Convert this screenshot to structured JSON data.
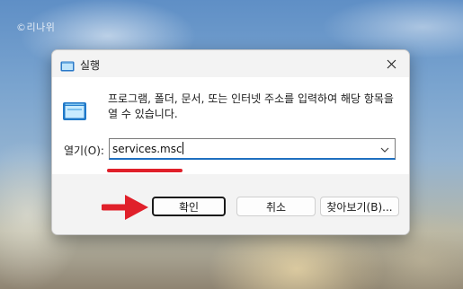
{
  "watermark": "©리나위",
  "dialog": {
    "title": "실행",
    "description": "프로그램, 폴더, 문서, 또는 인터넷 주소를 입력하여 해당 항목을 열 수 있습니다.",
    "open_label": "열기(O):",
    "open_value": "services.msc",
    "buttons": {
      "ok": "확인",
      "cancel": "취소",
      "browse": "찾아보기(B)..."
    }
  },
  "icons": {
    "title": "run-app-icon",
    "close": "close-icon",
    "run": "run-dialog-icon",
    "dropdown": "chevron-down-icon"
  },
  "colors": {
    "accent": "#1f6fc0",
    "annotation": "#e0202a"
  }
}
